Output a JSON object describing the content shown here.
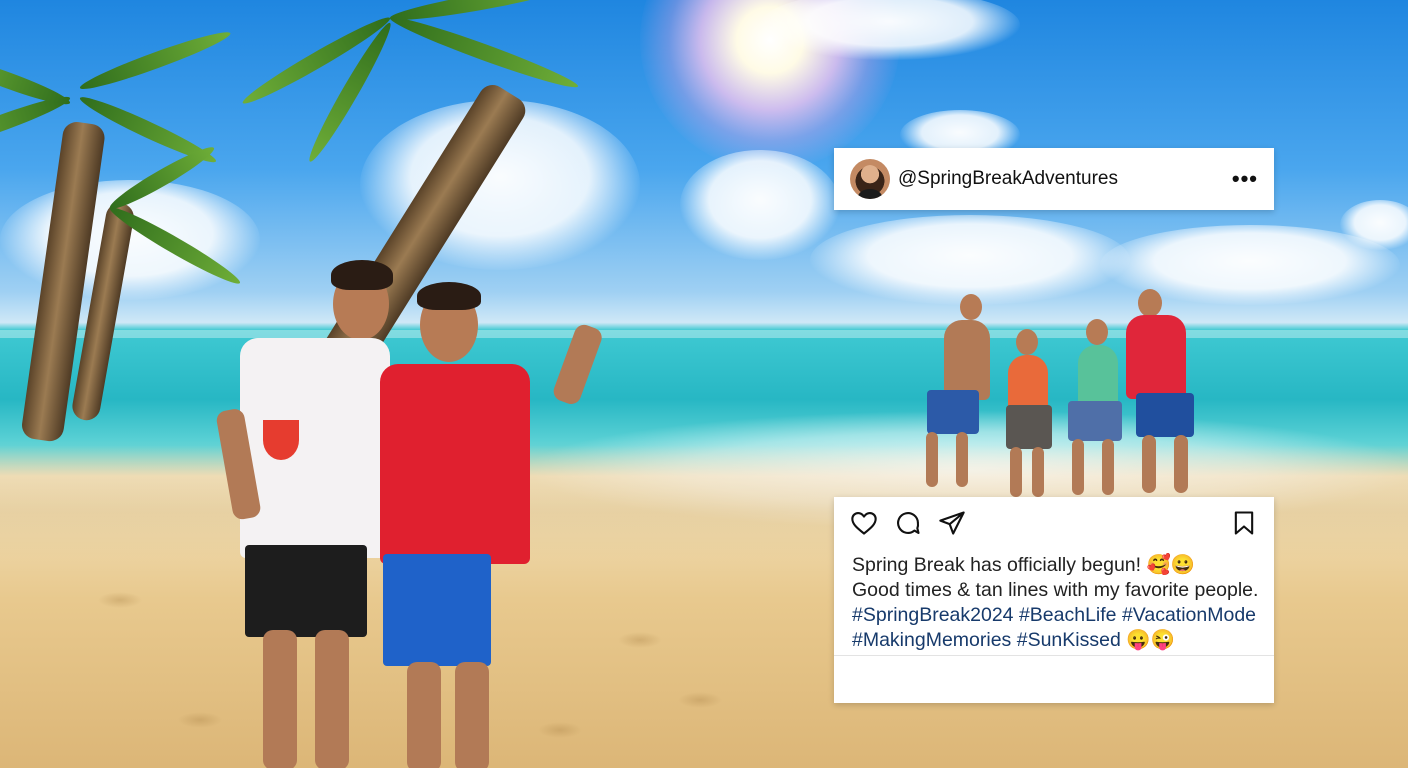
{
  "post": {
    "username": "@SpringBreakAdventures",
    "more_icon": "•••",
    "caption_line1": "Spring Break has officially begun! 🥰😀",
    "caption_line2": "Good times & tan lines with my favorite people.",
    "hashtags_line1": "#SpringBreak2024 #BeachLife #VacationMode",
    "hashtags_line2": "#MakingMemories #SunKissed 😛😜"
  },
  "icons": {
    "like": "heart-icon",
    "comment": "comment-icon",
    "share": "send-icon",
    "save": "bookmark-icon",
    "more": "more-icon"
  },
  "colors": {
    "sky": "#1f86e0",
    "sea": "#27b7c4",
    "sand": "#e8c98e",
    "hashtag": "#173a6b"
  }
}
